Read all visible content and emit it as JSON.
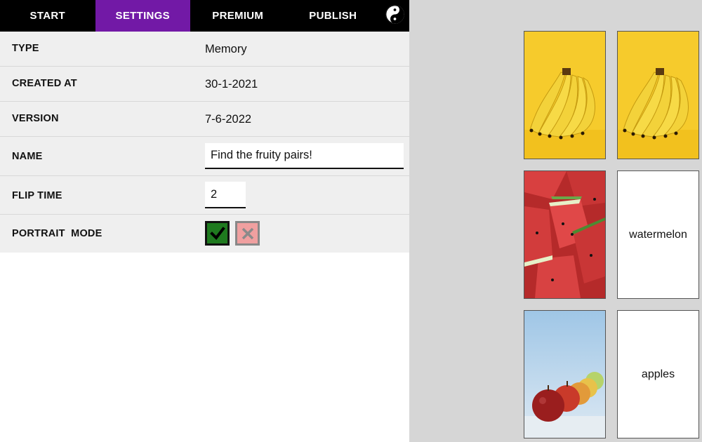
{
  "nav": {
    "tabs": [
      {
        "label": "START"
      },
      {
        "label": "SETTINGS",
        "active": true
      },
      {
        "label": "PREMIUM"
      },
      {
        "label": "PUBLISH"
      }
    ],
    "icon": "yin-yang-icon"
  },
  "settings": {
    "type": {
      "label": "TYPE",
      "value": "Memory"
    },
    "created": {
      "label": "CREATED AT",
      "value": "30-1-2021"
    },
    "version": {
      "label": "VERSION",
      "value": "7-6-2022"
    },
    "name": {
      "label": "NAME",
      "value": "Find the fruity pairs!"
    },
    "flip_time": {
      "label": "FLIP TIME",
      "value": "2"
    },
    "portrait": {
      "label": "PORTRAIT  MODE",
      "selected": "yes"
    }
  },
  "cards": [
    {
      "kind": "image",
      "subject": "bananas"
    },
    {
      "kind": "image",
      "subject": "bananas"
    },
    {
      "kind": "image",
      "subject": "watermelon"
    },
    {
      "kind": "text",
      "text": "watermelon"
    },
    {
      "kind": "image",
      "subject": "apples"
    },
    {
      "kind": "text",
      "text": "apples"
    }
  ],
  "colors": {
    "accent": "#7219a6",
    "check_yes": "#1f7a1f",
    "check_no": "#f0a0a0"
  }
}
